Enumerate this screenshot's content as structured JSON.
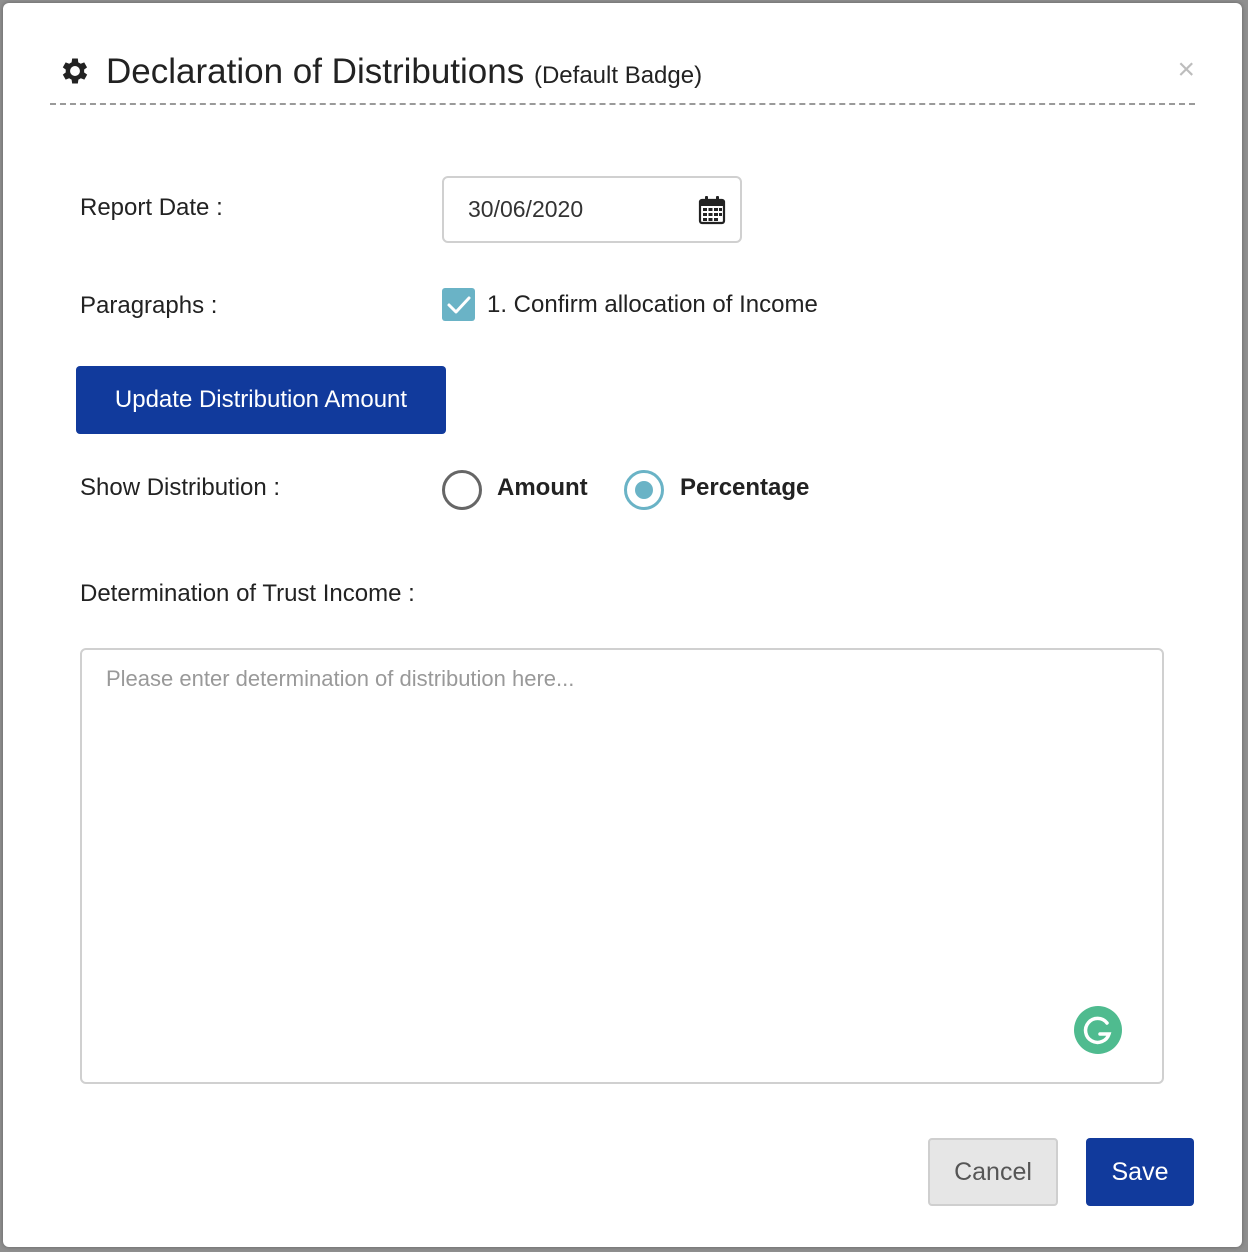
{
  "dialog": {
    "title": "Declaration of Distributions",
    "title_badge": "(Default Badge)",
    "close_label": "×"
  },
  "form": {
    "report_date_label": "Report Date :",
    "report_date_value": "30/06/2020",
    "paragraphs_label": "Paragraphs :",
    "paragraph_option": "1. Confirm allocation of Income",
    "paragraph_checked": true,
    "update_button_label": "Update Distribution Amount",
    "show_distribution_label": "Show Distribution :",
    "distribution_options": [
      {
        "label": "Amount",
        "selected": false
      },
      {
        "label": "Percentage",
        "selected": true
      }
    ],
    "determination_label": "Determination of Trust Income :",
    "determination_placeholder": "Please enter determination of distribution here..."
  },
  "footer": {
    "cancel_label": "Cancel",
    "save_label": "Save"
  },
  "colors": {
    "primary": "#113a9c",
    "accent": "#6ab3c6",
    "grammarly": "#4fbb8f"
  },
  "icons": [
    "gear-icon",
    "close-icon",
    "calendar-icon",
    "check-icon",
    "grammarly-icon"
  ]
}
